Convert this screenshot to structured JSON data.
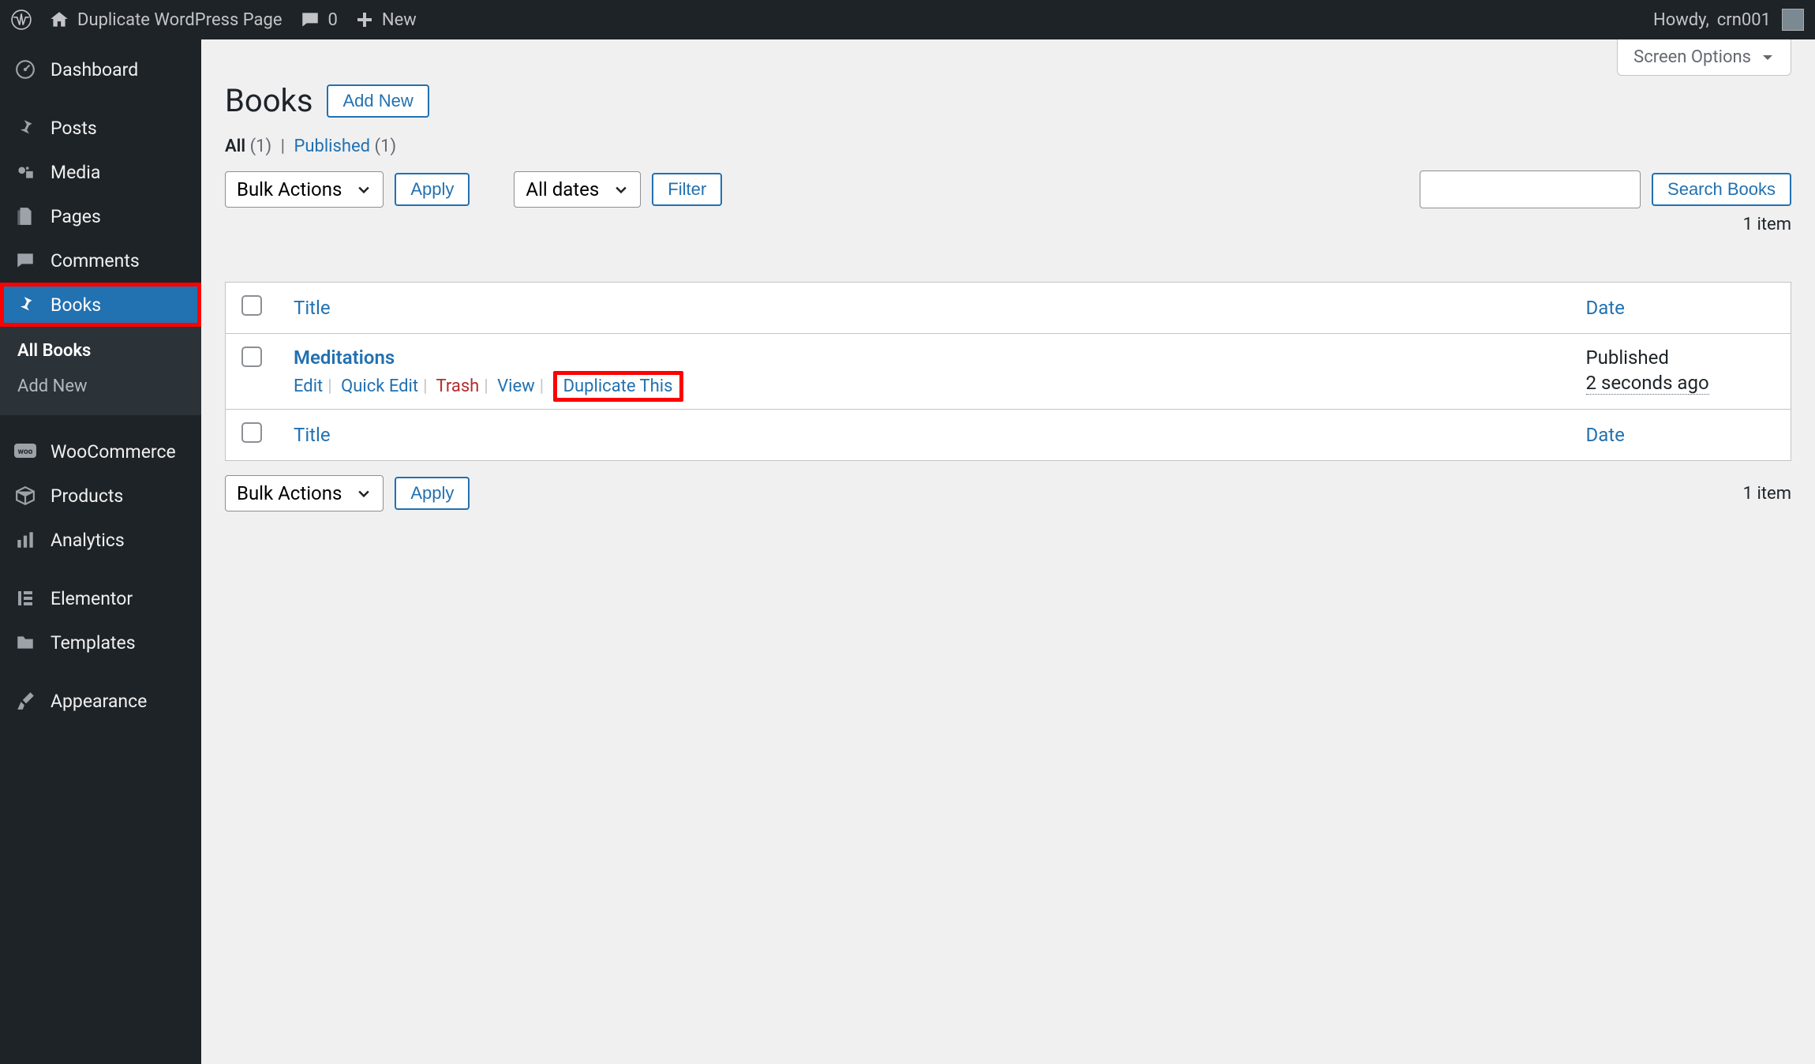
{
  "adminbar": {
    "site_title": "Duplicate WordPress Page",
    "comments_count": "0",
    "new_label": "New",
    "howdy_prefix": "Howdy, ",
    "username": "crn001"
  },
  "sidebar": {
    "items": [
      {
        "id": "dashboard",
        "label": "Dashboard",
        "icon": "dashboard"
      },
      {
        "id": "posts",
        "label": "Posts",
        "icon": "pin",
        "sep_before": true
      },
      {
        "id": "media",
        "label": "Media",
        "icon": "media"
      },
      {
        "id": "pages",
        "label": "Pages",
        "icon": "pages"
      },
      {
        "id": "comments",
        "label": "Comments",
        "icon": "comment"
      },
      {
        "id": "books",
        "label": "Books",
        "icon": "pin",
        "current": true,
        "highlighted": true,
        "submenu": [
          {
            "id": "all-books",
            "label": "All Books",
            "current": true
          },
          {
            "id": "add-new",
            "label": "Add New"
          }
        ]
      },
      {
        "id": "woocommerce",
        "label": "WooCommerce",
        "icon": "woo",
        "sep_before": true
      },
      {
        "id": "products",
        "label": "Products",
        "icon": "box"
      },
      {
        "id": "analytics",
        "label": "Analytics",
        "icon": "bars"
      },
      {
        "id": "elementor",
        "label": "Elementor",
        "icon": "elementor",
        "sep_before": true
      },
      {
        "id": "templates",
        "label": "Templates",
        "icon": "folder"
      },
      {
        "id": "appearance",
        "label": "Appearance",
        "icon": "brush",
        "sep_before": true
      }
    ]
  },
  "main": {
    "screen_options_label": "Screen Options",
    "page_title": "Books",
    "add_new_label": "Add New",
    "filters": {
      "all_label": "All",
      "all_count": "(1)",
      "published_label": "Published",
      "published_count": "(1)"
    },
    "bulk_actions_label": "Bulk Actions",
    "apply_label": "Apply",
    "dates_label": "All dates",
    "filter_label": "Filter",
    "search_label": "Search Books",
    "item_count_text": "1 item",
    "columns": {
      "title": "Title",
      "date": "Date"
    },
    "rows": [
      {
        "title": "Meditations",
        "actions": {
          "edit": "Edit",
          "quick_edit": "Quick Edit",
          "trash": "Trash",
          "view": "View",
          "duplicate": "Duplicate This"
        },
        "status": "Published",
        "when": "2 seconds ago"
      }
    ]
  }
}
